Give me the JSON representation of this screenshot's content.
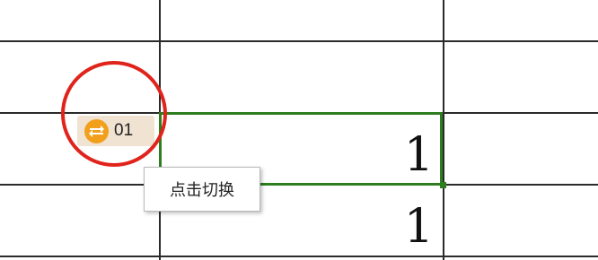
{
  "spreadsheet": {
    "cells": [
      {
        "value": "1"
      },
      {
        "value": "1"
      }
    ]
  },
  "smart_tag": {
    "icon": "swap-icon",
    "label": "01"
  },
  "tooltip": {
    "text": "点击切换"
  },
  "colors": {
    "selection": "#2e7d1e",
    "highlight": "#e0241c",
    "icon": "#f2a01c",
    "tag_background": "#f0e3d2"
  }
}
